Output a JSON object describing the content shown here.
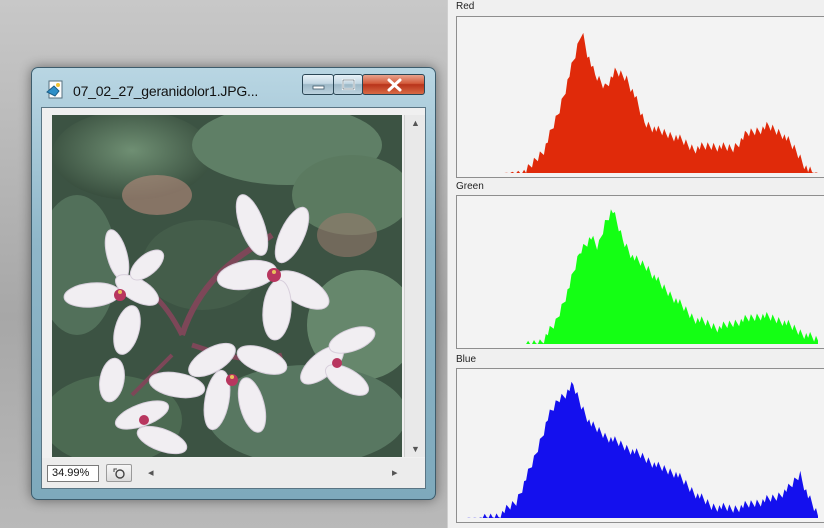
{
  "window": {
    "title": "07_02_27_geranidolor1.JPG...",
    "icon": "image-file-icon",
    "zoom": "34.99%"
  },
  "histograms": [
    {
      "label": "Red",
      "color": "#e02a0a"
    },
    {
      "label": "Green",
      "color": "#14ff14"
    },
    {
      "label": "Blue",
      "color": "#1410ee"
    }
  ]
}
